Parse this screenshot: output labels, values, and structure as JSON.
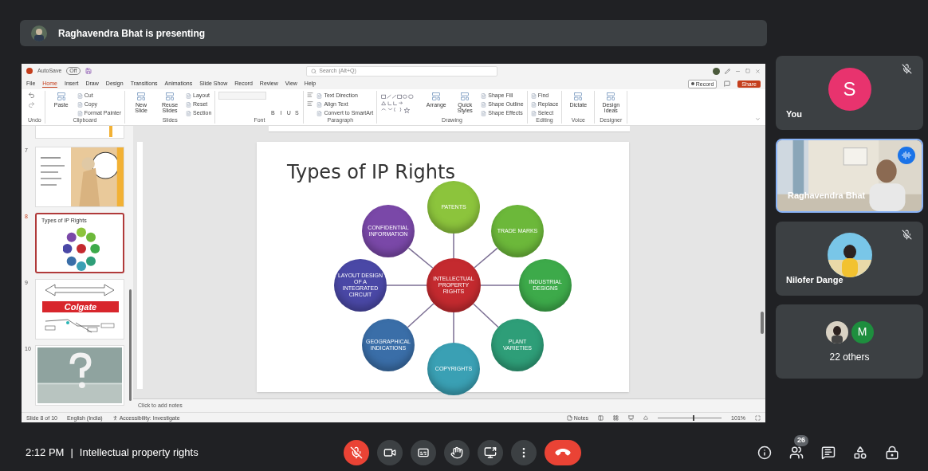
{
  "presenter_banner": {
    "text": "Raghavendra Bhat is presenting"
  },
  "shared_screen": {
    "title_bar": {
      "autosave": "AutoSave",
      "autosave_state": "Off",
      "search": {
        "placeholder": "Search (Alt+Q)"
      }
    },
    "menu_tabs": [
      {
        "label": "File",
        "selected": false
      },
      {
        "label": "Home",
        "selected": true
      },
      {
        "label": "Insert",
        "selected": false
      },
      {
        "label": "Draw",
        "selected": false
      },
      {
        "label": "Design",
        "selected": false
      },
      {
        "label": "Transitions",
        "selected": false
      },
      {
        "label": "Animations",
        "selected": false
      },
      {
        "label": "Slide Show",
        "selected": false
      },
      {
        "label": "Record",
        "selected": false
      },
      {
        "label": "Review",
        "selected": false
      },
      {
        "label": "View",
        "selected": false
      },
      {
        "label": "Help",
        "selected": false
      }
    ],
    "record_button": "Record",
    "share_button": "Share",
    "ribbon_groups": [
      {
        "label": "Undo",
        "items": [
          {
            "kind": "undo"
          }
        ]
      },
      {
        "label": "Clipboard",
        "items": [
          {
            "kind": "large",
            "label": "Paste"
          },
          {
            "kind": "small",
            "label": "Cut"
          },
          {
            "kind": "small",
            "label": "Copy"
          },
          {
            "kind": "small",
            "label": "Format Painter"
          }
        ]
      },
      {
        "label": "Slides",
        "items": [
          {
            "kind": "large",
            "label": "New Slide"
          },
          {
            "kind": "large",
            "label": "Reuse Slides"
          },
          {
            "kind": "small",
            "label": "Layout"
          },
          {
            "kind": "small",
            "label": "Reset"
          },
          {
            "kind": "small",
            "label": "Section"
          }
        ]
      },
      {
        "label": "Font",
        "items": [
          {
            "kind": "font_field"
          },
          {
            "kind": "format",
            "label": "B"
          },
          {
            "kind": "format",
            "label": "I"
          },
          {
            "kind": "format",
            "label": "U"
          },
          {
            "kind": "format",
            "label": "S"
          }
        ]
      },
      {
        "label": "Paragraph",
        "items": [
          {
            "kind": "align"
          },
          {
            "kind": "small",
            "label": "Text Direction"
          },
          {
            "kind": "small",
            "label": "Align Text"
          },
          {
            "kind": "small",
            "label": "Convert to SmartArt"
          }
        ]
      },
      {
        "label": "Drawing",
        "items": [
          {
            "kind": "gallery"
          },
          {
            "kind": "large",
            "label": "Arrange"
          },
          {
            "kind": "large",
            "label": "Quick Styles"
          },
          {
            "kind": "small",
            "label": "Shape Fill"
          },
          {
            "kind": "small",
            "label": "Shape Outline"
          },
          {
            "kind": "small",
            "label": "Shape Effects"
          }
        ]
      },
      {
        "label": "Editing",
        "items": [
          {
            "kind": "small",
            "label": "Find"
          },
          {
            "kind": "small",
            "label": "Replace"
          },
          {
            "kind": "small",
            "label": "Select"
          }
        ]
      },
      {
        "label": "Voice",
        "items": [
          {
            "kind": "large",
            "label": "Dictate"
          }
        ]
      },
      {
        "label": "Designer",
        "items": [
          {
            "kind": "large",
            "label": "Design Ideas"
          }
        ]
      }
    ],
    "thumbnails": [
      {
        "number": "7",
        "selected": false,
        "kind": "cartoon"
      },
      {
        "number": "8",
        "selected": true,
        "kind": "diagram",
        "title": "Types of IP Rights"
      },
      {
        "number": "9",
        "selected": false,
        "kind": "logo",
        "text": "Colgate"
      },
      {
        "number": "10",
        "selected": false
      }
    ],
    "slide": {
      "title": "Types of IP Rights",
      "center": {
        "text": "INTELLECTUAL PROPERTY RIGHTS",
        "color": "#c42a2f"
      },
      "nodes": [
        {
          "text": "PATENTS",
          "color": "#8cc43c"
        },
        {
          "text": "TRADE MARKS",
          "color": "#6cb83a"
        },
        {
          "text": "INDUSTRIAL DESIGNS",
          "color": "#3daa4a"
        },
        {
          "text": "PLANT VARIETIES",
          "color": "#2e9e78"
        },
        {
          "text": "COPYRIGHTS",
          "color": "#3aa0b4"
        },
        {
          "text": "GEOGRAPHICAL INDICATIONS",
          "color": "#3a6ea8"
        },
        {
          "text": "LAYOUT DESIGN OF A INTEGRATED CIRCUIT",
          "color": "#4a48a6"
        },
        {
          "text": "CONFIDENTIAL INFORMATION",
          "color": "#7a48a8"
        }
      ]
    },
    "notes": {
      "placeholder": "Click to add notes"
    },
    "status_bar": {
      "slide": "Slide 8 of 10",
      "language": "English (India)",
      "accessibility": "Accessibility: Investigate",
      "notes": "Notes",
      "zoom_slider": {
        "level": 0.55
      },
      "zoom": "101%"
    }
  },
  "participants": [
    {
      "kind": "avatar",
      "name": "You",
      "initial": "S",
      "color": "#e8336e",
      "muted": true,
      "speaking": false
    },
    {
      "kind": "video",
      "name": "Raghavendra Bhat",
      "muted": false,
      "speaking": true
    },
    {
      "name": "Nilofer Dange",
      "muted": true,
      "speaking": false
    },
    {
      "kind": "group",
      "name": "22 others",
      "initial": "M",
      "color": "#1e8e3e",
      "muted": false,
      "speaking": false
    }
  ],
  "bottom_bar": {
    "time": "2:12 PM",
    "separator": "|",
    "meeting_title": "Intellectual property rights",
    "controls": [
      {
        "kind": "mic",
        "on": false
      },
      {
        "kind": "camera",
        "on": true
      },
      {
        "kind": "captions",
        "on": false
      },
      {
        "kind": "hand"
      },
      {
        "kind": "present"
      },
      {
        "kind": "more"
      },
      {
        "kind": "end"
      }
    ],
    "side_controls": [
      {
        "kind": "info"
      },
      {
        "kind": "people",
        "badge": "26"
      },
      {
        "kind": "chat"
      },
      {
        "kind": "activities"
      },
      {
        "kind": "host"
      }
    ]
  }
}
